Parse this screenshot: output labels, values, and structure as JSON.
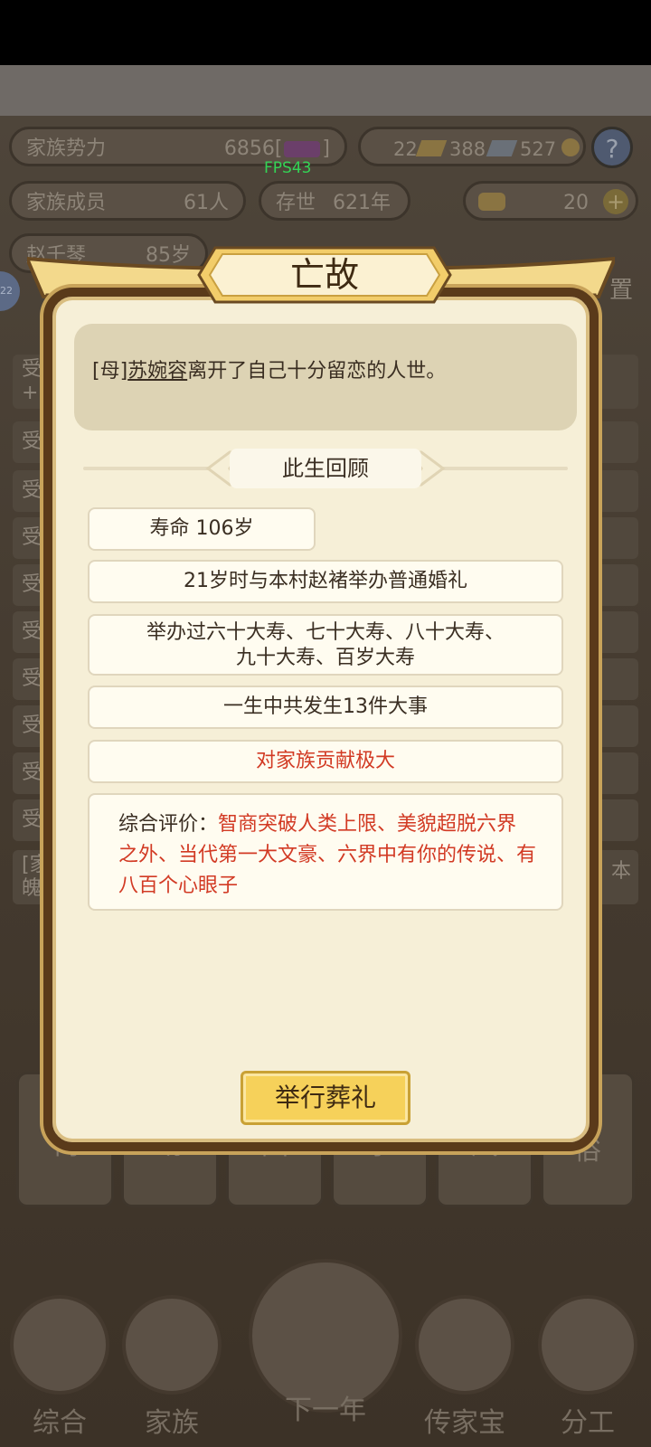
{
  "status_bar": {},
  "background": {
    "family_power_label": "家族势力",
    "family_power_value": "6856[",
    "family_power_suffix": "]",
    "resources": {
      "gold_bars": "22",
      "silver": "388",
      "coins": "527"
    },
    "members_label": "家族成员",
    "members_value": "61人",
    "existence_label": "存世",
    "existence_value": "621年",
    "ingots": "20",
    "fps": "FPS43",
    "member_name_partial": "赵千琴",
    "member_age_partial": "85岁",
    "row_prefix": "受",
    "left_badge": "22",
    "row_top_partial": "受",
    "row_plus_partial": "+1",
    "row_bracket_partial": "[家",
    "row_bracket_second": "魄",
    "right_partial_1": "置",
    "right_partial_2": "本",
    "nav_cards": [
      "祠",
      "场",
      "园",
      "事",
      "风",
      "风俗"
    ],
    "bottom_nav": [
      "综合",
      "家族",
      "下一年",
      "传家宝",
      "分工"
    ]
  },
  "dialog": {
    "title": "亡故",
    "message_prefix": "[母]",
    "message_name": "苏婉容",
    "message_rest": "离开了自己十分留恋的人世。",
    "review_title": "此生回顾",
    "lifespan": "寿命 106岁",
    "marriage": "21岁时与本村赵褚举办普通婚礼",
    "birthdays_line1": "举办过六十大寿、七十大寿、八十大寿、",
    "birthdays_line2": "九十大寿、百岁大寿",
    "events": "一生中共发生13件大事",
    "contribution": "对家族贡献极大",
    "evaluation_label": "综合评价：",
    "evaluation_text": "智商突破人类上限、美貌超脱六界之外、当代第一大文豪、六界中有你的传说、有八百个心眼子",
    "funeral_button": "举行葬礼"
  },
  "colors": {
    "dialog_bg": "#f6efd7",
    "highlight_red": "#d23a24",
    "button_gold": "#f6d15a",
    "fps_green": "#33d455"
  }
}
